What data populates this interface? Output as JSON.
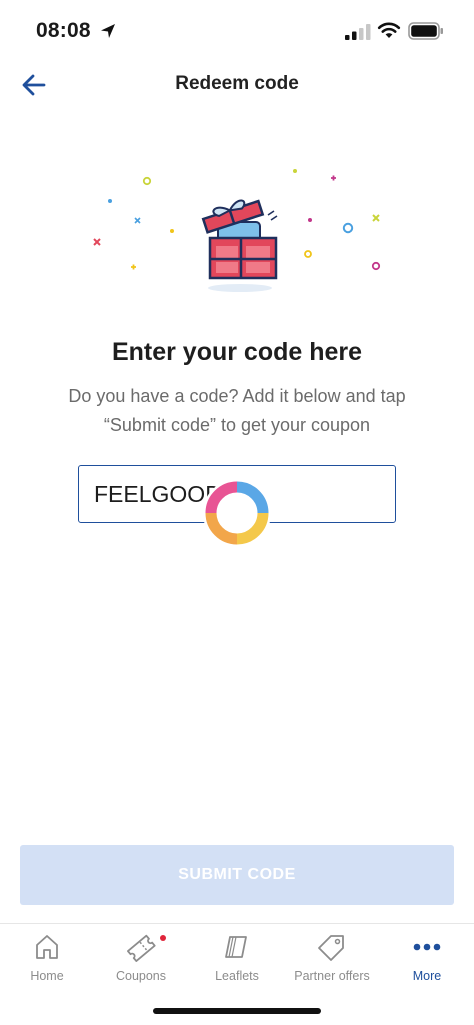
{
  "status_bar": {
    "time": "08:08"
  },
  "header": {
    "title": "Redeem code"
  },
  "main": {
    "heading": "Enter your code here",
    "description_line1": "Do you have a code? Add it below and tap",
    "description_line2": "“Submit code” to get your coupon",
    "code_input": {
      "value": "FEELGOOD"
    },
    "submit_label": "SUBMIT CODE"
  },
  "tabs": [
    {
      "label": "Home",
      "icon": "home-icon"
    },
    {
      "label": "Coupons",
      "icon": "coupon-icon",
      "badge": true
    },
    {
      "label": "Leaflets",
      "icon": "leaflet-icon"
    },
    {
      "label": "Partner offers",
      "icon": "tag-icon"
    },
    {
      "label": "More",
      "icon": "more-dots-icon",
      "active": true
    }
  ],
  "colors": {
    "accent": "#1f4f9c",
    "submit_disabled_bg": "#d3e0f5",
    "gift_red": "#e2475b",
    "badge_red": "#e0253a"
  }
}
